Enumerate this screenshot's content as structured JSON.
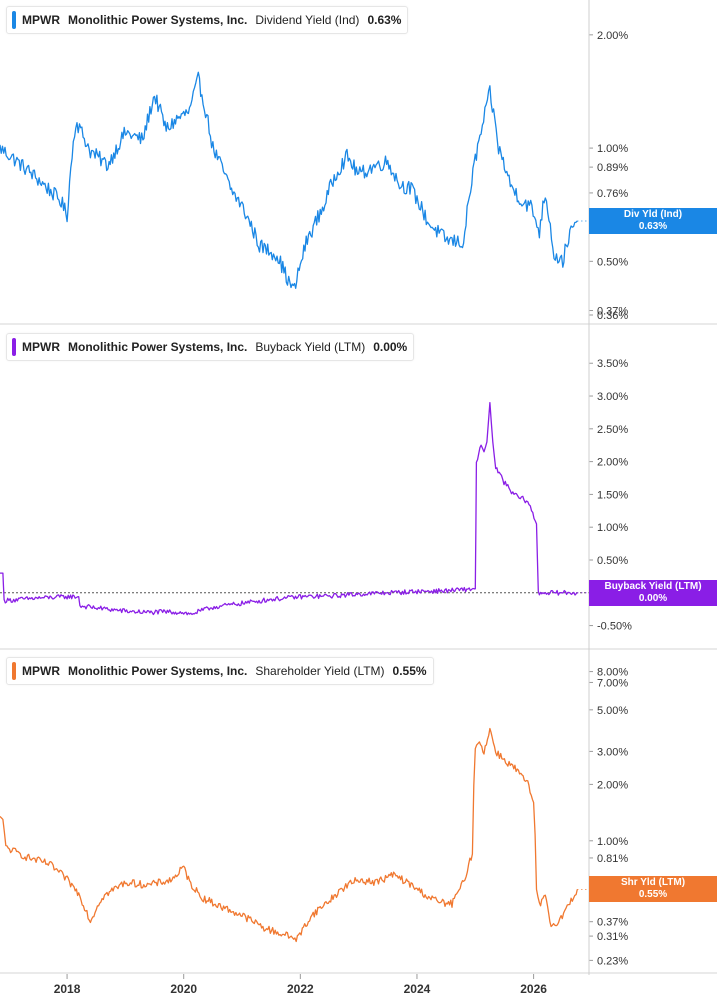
{
  "chart_data": [
    {
      "type": "line",
      "ticker": "MPWR",
      "company": "Monolithic Power Systems, Inc.",
      "metric": "Dividend Yield (Ind)",
      "value_label": "0.63%",
      "flag_title": "Div Yld (Ind)",
      "flag_value": "0.63%",
      "color": "#1a87e5",
      "scale": "log",
      "ylim": [
        0.36,
        2.3
      ],
      "yticks": [
        {
          "label": "2.00%",
          "v": 2.0
        },
        {
          "label": "1.00%",
          "v": 1.0
        },
        {
          "label": "0.89%",
          "v": 0.89
        },
        {
          "label": "0.76%",
          "v": 0.76
        },
        {
          "label": "0.50%",
          "v": 0.5
        },
        {
          "label": "0.37%",
          "v": 0.37
        },
        {
          "label": "0.36%",
          "v": 0.36
        }
      ],
      "series": [
        {
          "x": [
            2016.85,
            2017.0,
            2017.3,
            2017.6,
            2017.9,
            2018.0,
            2018.15,
            2018.4,
            2018.7,
            2019.0,
            2019.3,
            2019.5,
            2019.7,
            2019.9,
            2020.1,
            2020.25,
            2020.5,
            2020.8,
            2021.0,
            2021.3,
            2021.6,
            2021.8,
            2021.9,
            2022.1,
            2022.4,
            2022.6,
            2022.8,
            2023.0,
            2023.3,
            2023.5,
            2023.7,
            2023.9,
            2024.2,
            2024.5,
            2024.8,
            2025.0,
            2025.1,
            2025.25,
            2025.4,
            2025.6,
            2025.8,
            2025.95,
            2026.1,
            2026.2,
            2026.35,
            2026.5,
            2026.6,
            2026.75
          ],
          "y": [
            1.0,
            0.96,
            0.88,
            0.8,
            0.72,
            0.66,
            1.18,
            0.98,
            0.9,
            1.1,
            1.05,
            1.38,
            1.12,
            1.2,
            1.25,
            1.52,
            1.0,
            0.78,
            0.7,
            0.55,
            0.52,
            0.44,
            0.42,
            0.56,
            0.7,
            0.85,
            0.95,
            0.85,
            0.9,
            0.92,
            0.8,
            0.78,
            0.63,
            0.57,
            0.56,
            0.93,
            1.1,
            1.4,
            1.0,
            0.8,
            0.72,
            0.7,
            0.6,
            0.76,
            0.52,
            0.5,
            0.58,
            0.64
          ]
        }
      ]
    },
    {
      "type": "line",
      "ticker": "MPWR",
      "company": "Monolithic Power Systems, Inc.",
      "metric": "Buyback Yield (LTM)",
      "value_label": "0.00%",
      "flag_title": "Buyback Yield (LTM)",
      "flag_value": "0.00%",
      "color": "#8a1ee6",
      "scale": "linear",
      "ylim": [
        -0.72,
        3.9
      ],
      "yticks": [
        {
          "label": "3.50%",
          "v": 3.5
        },
        {
          "label": "3.00%",
          "v": 3.0
        },
        {
          "label": "2.50%",
          "v": 2.5
        },
        {
          "label": "2.00%",
          "v": 2.0
        },
        {
          "label": "1.50%",
          "v": 1.5
        },
        {
          "label": "1.00%",
          "v": 1.0
        },
        {
          "label": "0.50%",
          "v": 0.5
        },
        {
          "label": "-0.50%",
          "v": -0.5
        }
      ],
      "series": [
        {
          "x": [
            2016.85,
            2016.9,
            2016.92,
            2017.5,
            2018.0,
            2018.2,
            2018.22,
            2018.6,
            2019.0,
            2019.4,
            2019.7,
            2020.0,
            2020.1,
            2020.5,
            2021.0,
            2021.5,
            2022.0,
            2022.5,
            2023.0,
            2023.5,
            2024.0,
            2024.5,
            2025.0,
            2025.02,
            2025.1,
            2025.15,
            2025.2,
            2025.25,
            2025.3,
            2025.35,
            2025.45,
            2025.6,
            2025.75,
            2025.9,
            2026.05,
            2026.08,
            2026.2,
            2026.75
          ],
          "y": [
            0.3,
            0.3,
            -0.12,
            -0.08,
            -0.06,
            -0.06,
            -0.2,
            -0.24,
            -0.28,
            -0.3,
            -0.29,
            -0.3,
            -0.33,
            -0.22,
            -0.16,
            -0.1,
            -0.06,
            -0.05,
            -0.02,
            0.0,
            0.02,
            0.03,
            0.06,
            2.0,
            2.25,
            2.15,
            2.3,
            2.9,
            2.3,
            1.9,
            1.75,
            1.55,
            1.45,
            1.4,
            1.05,
            0.0,
            0.0,
            0.0
          ]
        }
      ]
    },
    {
      "type": "line",
      "ticker": "MPWR",
      "company": "Monolithic Power Systems, Inc.",
      "metric": "Shareholder Yield (LTM)",
      "value_label": "0.55%",
      "flag_title": "Shr Yld (LTM)",
      "flag_value": "0.55%",
      "color": "#f07830",
      "scale": "log",
      "ylim": [
        0.22,
        9.0
      ],
      "yticks": [
        {
          "label": "8.00%",
          "v": 8.0
        },
        {
          "label": "7.00%",
          "v": 7.0
        },
        {
          "label": "5.00%",
          "v": 5.0
        },
        {
          "label": "3.00%",
          "v": 3.0
        },
        {
          "label": "2.00%",
          "v": 2.0
        },
        {
          "label": "1.00%",
          "v": 1.0
        },
        {
          "label": "0.81%",
          "v": 0.81
        },
        {
          "label": "0.37%",
          "v": 0.37
        },
        {
          "label": "0.31%",
          "v": 0.31
        },
        {
          "label": "0.23%",
          "v": 0.23
        }
      ],
      "series": [
        {
          "x": [
            2016.85,
            2016.9,
            2016.95,
            2017.3,
            2017.7,
            2018.0,
            2018.2,
            2018.4,
            2018.6,
            2019.0,
            2019.4,
            2019.8,
            2020.0,
            2020.1,
            2020.3,
            2020.6,
            2021.0,
            2021.4,
            2021.8,
            2021.95,
            2022.2,
            2022.5,
            2022.8,
            2023.0,
            2023.3,
            2023.6,
            2023.9,
            2024.2,
            2024.4,
            2024.6,
            2024.8,
            2024.95,
            2025.0,
            2025.05,
            2025.15,
            2025.25,
            2025.35,
            2025.5,
            2025.7,
            2025.9,
            2026.0,
            2026.05,
            2026.1,
            2026.2,
            2026.3,
            2026.45,
            2026.6,
            2026.75
          ],
          "y": [
            1.35,
            1.3,
            0.92,
            0.82,
            0.75,
            0.62,
            0.52,
            0.37,
            0.5,
            0.6,
            0.58,
            0.62,
            0.72,
            0.6,
            0.5,
            0.45,
            0.4,
            0.34,
            0.31,
            0.3,
            0.4,
            0.48,
            0.58,
            0.62,
            0.6,
            0.66,
            0.58,
            0.5,
            0.47,
            0.46,
            0.6,
            0.85,
            3.1,
            3.4,
            3.0,
            3.9,
            3.0,
            2.7,
            2.4,
            2.0,
            1.6,
            0.55,
            0.45,
            0.5,
            0.35,
            0.38,
            0.45,
            0.55
          ]
        }
      ]
    }
  ],
  "x_axis": {
    "xlim": [
      2016.85,
      2026.95
    ],
    "ticks": [
      {
        "label": "2018",
        "v": 2018
      },
      {
        "label": "2020",
        "v": 2020
      },
      {
        "label": "2022",
        "v": 2022
      },
      {
        "label": "2024",
        "v": 2024
      },
      {
        "label": "2026",
        "v": 2026
      }
    ]
  }
}
